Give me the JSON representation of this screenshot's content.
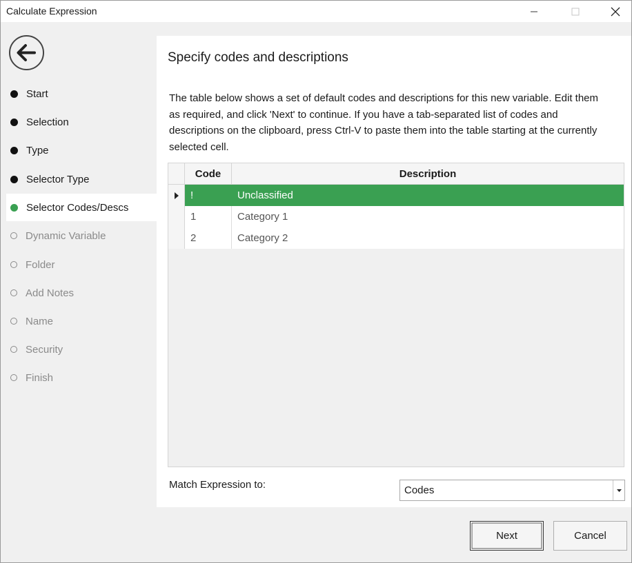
{
  "window": {
    "title": "Calculate Expression",
    "minimize_icon": "minimize-icon",
    "maximize_icon": "maximize-icon",
    "close_icon": "close-icon"
  },
  "sidebar": {
    "back_icon": "back-arrow-icon",
    "steps": [
      {
        "label": "Start",
        "state": "done"
      },
      {
        "label": "Selection",
        "state": "done"
      },
      {
        "label": "Type",
        "state": "done"
      },
      {
        "label": "Selector Type",
        "state": "done"
      },
      {
        "label": "Selector Codes/Descs",
        "state": "current"
      },
      {
        "label": "Dynamic Variable",
        "state": "todo"
      },
      {
        "label": "Folder",
        "state": "todo"
      },
      {
        "label": "Add Notes",
        "state": "todo"
      },
      {
        "label": "Name",
        "state": "todo"
      },
      {
        "label": "Security",
        "state": "todo"
      },
      {
        "label": "Finish",
        "state": "todo"
      }
    ]
  },
  "panel": {
    "title": "Specify codes and descriptions",
    "description": "The table below shows a set of default codes and descriptions for this new variable. Edit them as required, and click 'Next' to continue. If you have a tab-separated list of codes and descriptions on the clipboard, press Ctrl-V to paste them into the table starting at the currently selected cell."
  },
  "grid": {
    "columns": {
      "code": "Code",
      "description": "Description"
    },
    "rows": [
      {
        "code": "!",
        "description": "Unclassified",
        "selected": true
      },
      {
        "code": "1",
        "description": "Category 1",
        "selected": false
      },
      {
        "code": "2",
        "description": "Category 2",
        "selected": false
      }
    ]
  },
  "match": {
    "label": "Match Expression to:",
    "value": "Codes"
  },
  "buttons": {
    "next": "Next",
    "cancel": "Cancel"
  },
  "colors": {
    "accent": "#3aa052",
    "panel_bg": "#ffffff",
    "window_bg": "#f0f0f0"
  }
}
